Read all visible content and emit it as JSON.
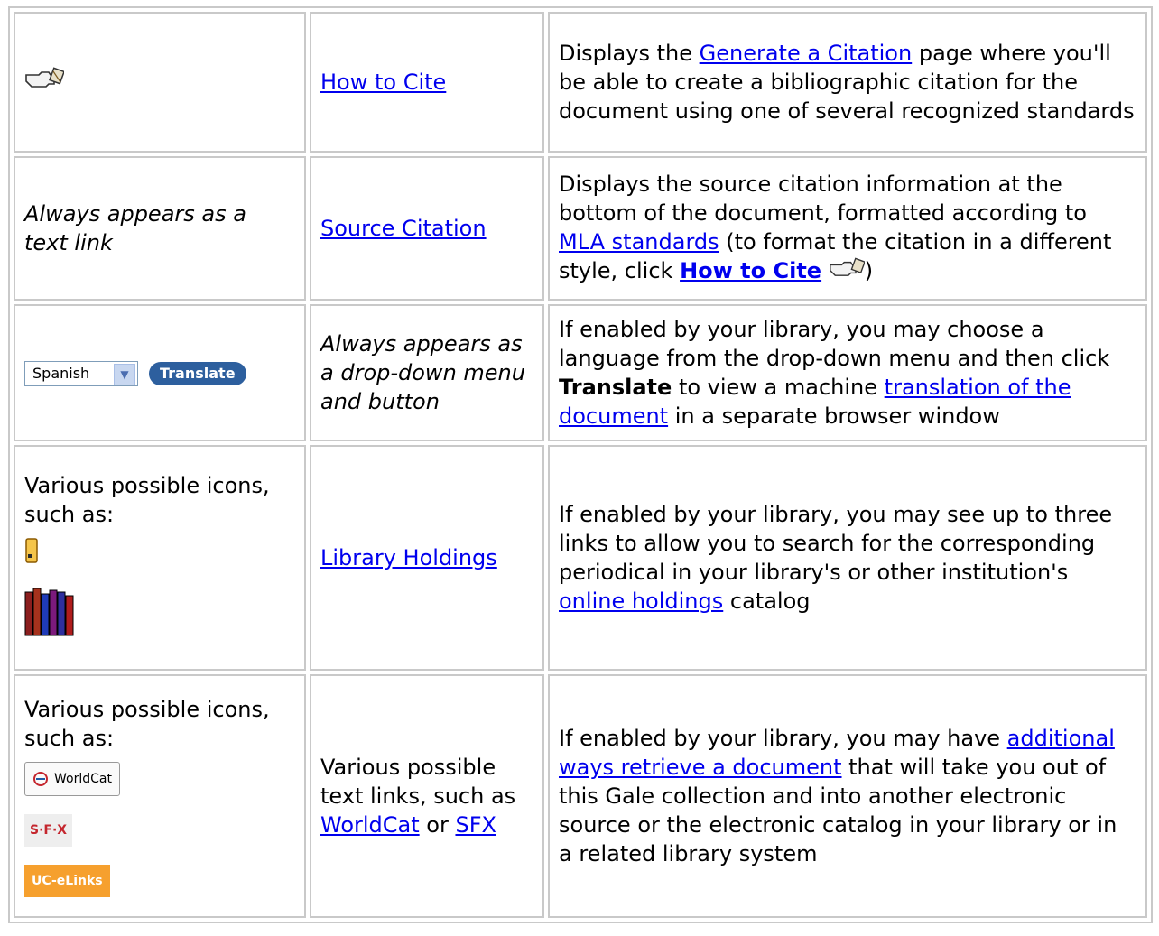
{
  "rows": [
    {
      "col1_icon": "hand-cite-icon",
      "col2_link": "How to Cite",
      "col3": {
        "p1": "Displays the ",
        "link1": "Generate a Citation",
        "p2": " page where you'll be able to create a bibliographic citation for the document using one of several recognized standards"
      }
    },
    {
      "col1_text": "Always appears as a text link",
      "col2_link": "Source Citation",
      "col3": {
        "p1": "Displays the source citation information at the bottom of the document, formatted according to ",
        "link1": "MLA standards",
        "p2": " (to format the citation in a different style, click ",
        "bold_link": "How to Cite",
        "p3": ")"
      }
    },
    {
      "col1_select": "Spanish",
      "col1_button": "Translate",
      "col2_text": "Always appears as a drop-down menu and button",
      "col3": {
        "p1": "If enabled by your library, you may choose a language from the drop-down menu and then click ",
        "bold": "Translate",
        "p2": " to view a machine ",
        "link1": "translation of the document",
        "p3": " in a separate browser window"
      }
    },
    {
      "col1_text": "Various possible icons, such as:",
      "col2_link": "Library Holdings",
      "col3": {
        "p1": "If enabled by your library, you may see up to three links to allow you to search for the corresponding periodical in your library's or other institution's ",
        "link1": "online holdings",
        "p2": " catalog"
      }
    },
    {
      "col1_text": "Various possible icons, such as:",
      "col1_badges": {
        "worldcat": "WorldCat",
        "sfx": "S·F·X",
        "uce": "UC-eLinks"
      },
      "col2": {
        "p1": "Various possible text links, such as ",
        "link1": "WorldCat",
        "p2": " or ",
        "link2": "SFX"
      },
      "col3": {
        "p1": "If enabled by your library, you may have ",
        "link1": "additional ways retrieve a document",
        "p2": " that will take you out of this Gale collection and into another electronic source or the electronic catalog in your library or in a related library system"
      }
    }
  ]
}
